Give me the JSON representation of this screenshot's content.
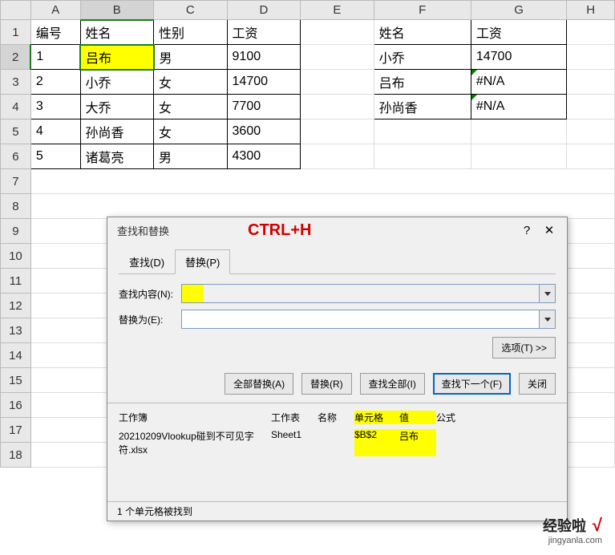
{
  "columns": [
    "A",
    "B",
    "C",
    "D",
    "E",
    "F",
    "G",
    "H"
  ],
  "rows": [
    "1",
    "2",
    "3",
    "4",
    "5",
    "6",
    "7",
    "8",
    "9",
    "10",
    "11",
    "12",
    "13",
    "14",
    "15",
    "16",
    "17",
    "18"
  ],
  "table1": {
    "headers": {
      "A": "编号",
      "B": "姓名",
      "C": "性别",
      "D": "工资"
    },
    "data": [
      {
        "A": "1",
        "B": "吕布",
        "C": "男",
        "D": "9100"
      },
      {
        "A": "2",
        "B": "小乔",
        "C": "女",
        "D": "14700"
      },
      {
        "A": "3",
        "B": "大乔",
        "C": "女",
        "D": "7700"
      },
      {
        "A": "4",
        "B": "孙尚香",
        "C": "女",
        "D": "3600"
      },
      {
        "A": "5",
        "B": "诸葛亮",
        "C": "男",
        "D": "4300"
      }
    ]
  },
  "table2": {
    "headers": {
      "F": "姓名",
      "G": "工资"
    },
    "data": [
      {
        "F": "小乔",
        "G": "14700"
      },
      {
        "F": "吕布",
        "G": "#N/A"
      },
      {
        "F": "孙尚香",
        "G": "#N/A"
      }
    ]
  },
  "dialog": {
    "title": "查找和替换",
    "shortcut_label": "CTRL+H",
    "help": "?",
    "close": "✕",
    "tab_find": "查找(D)",
    "tab_replace": "替换(P)",
    "find_label": "查找内容(N):",
    "replace_label": "替换为(E):",
    "find_value": "",
    "replace_value": "",
    "options_btn": "选项(T) >>",
    "btn_replace_all": "全部替换(A)",
    "btn_replace": "替换(R)",
    "btn_find_all": "查找全部(I)",
    "btn_find_next": "查找下一个(F)",
    "btn_close": "关闭",
    "results": {
      "h1": "工作簿",
      "h2": "工作表",
      "h3": "名称",
      "h4": "单元格",
      "h5": "值",
      "h6": "公式",
      "r1": "20210209Vlookup碰到不可见字符.xlsx",
      "r2": "Sheet1",
      "r3": "",
      "r4": "$B$2",
      "r5": "吕布",
      "r6": ""
    },
    "status": "1 个单元格被找到"
  },
  "watermark": {
    "main": "经验啦",
    "check": "√",
    "sub": "jingyanla.com"
  }
}
